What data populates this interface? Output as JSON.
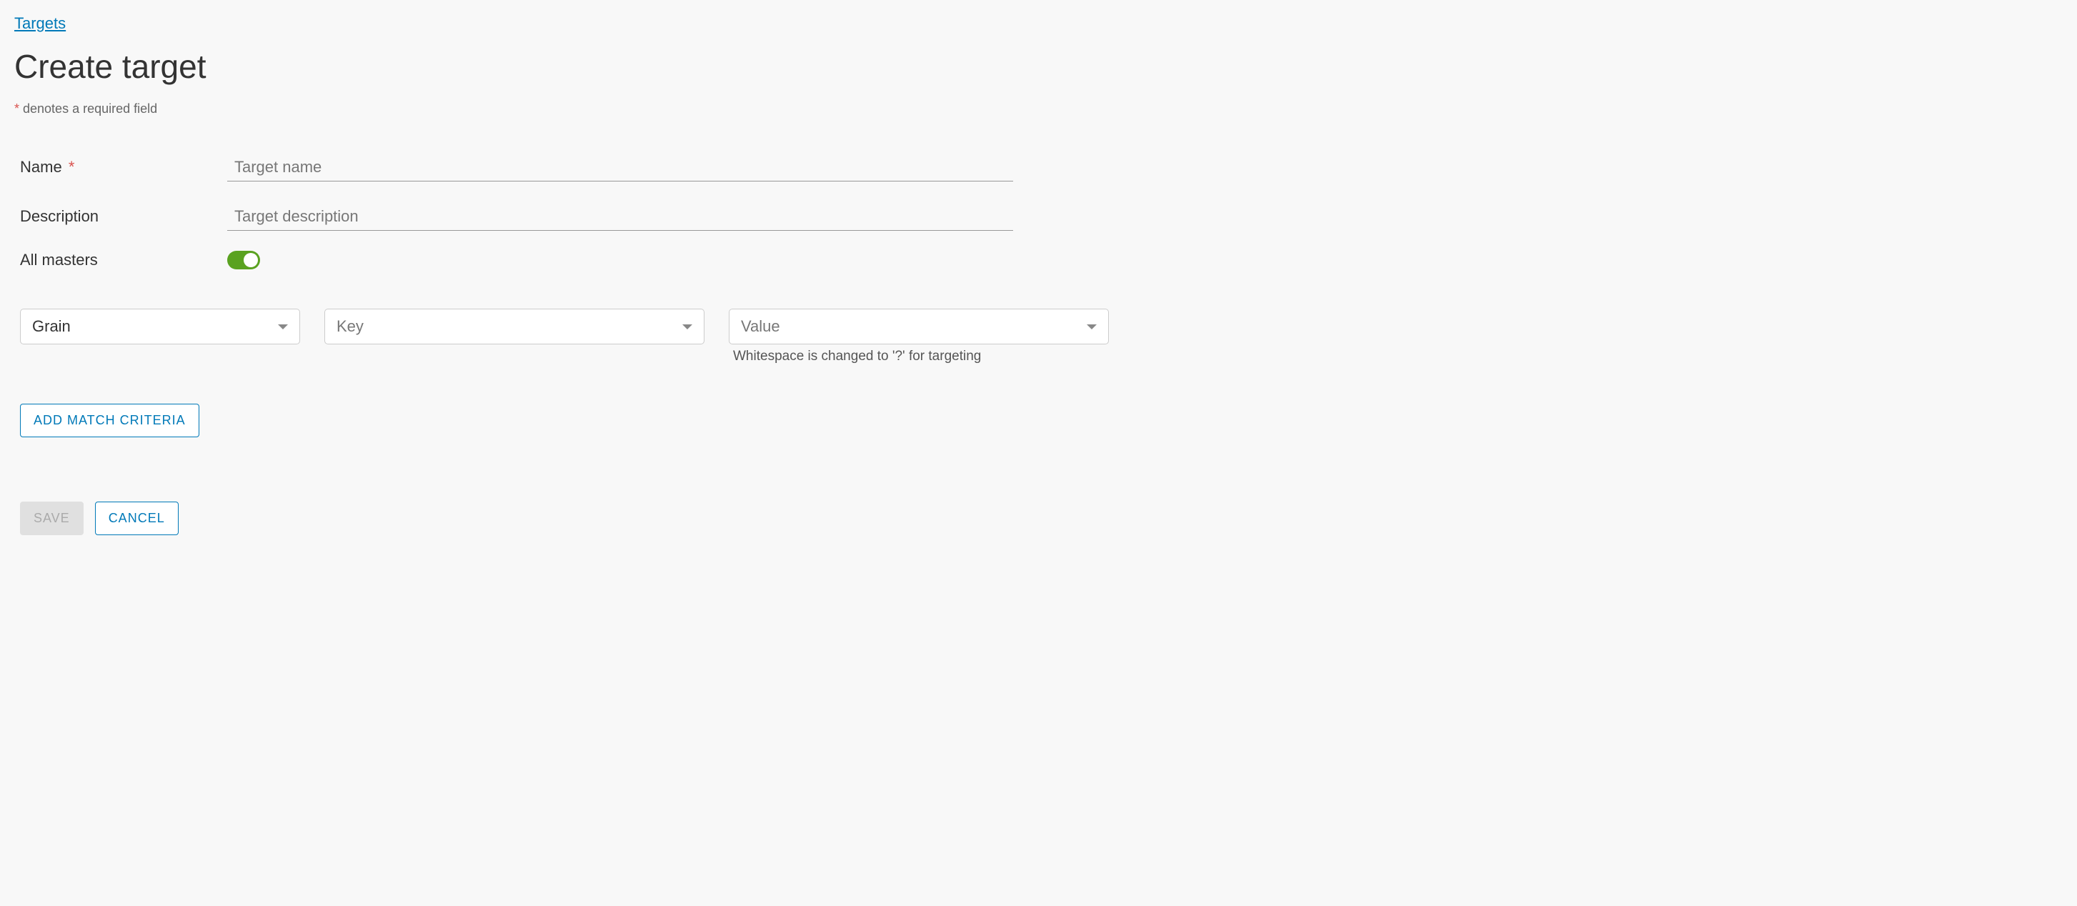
{
  "breadcrumb": {
    "label": "Targets"
  },
  "page": {
    "title": "Create target"
  },
  "required_note": {
    "marker": "*",
    "text": " denotes a required field"
  },
  "form": {
    "name": {
      "label": "Name",
      "required_marker": "*",
      "placeholder": "Target name",
      "value": ""
    },
    "description": {
      "label": "Description",
      "placeholder": "Target description",
      "value": ""
    },
    "all_masters": {
      "label": "All masters",
      "enabled": true
    }
  },
  "criteria": {
    "type": {
      "selected": "Grain"
    },
    "key": {
      "placeholder": "Key"
    },
    "value": {
      "placeholder": "Value",
      "hint": "Whitespace is changed to '?' for targeting"
    }
  },
  "buttons": {
    "add_criteria": "Add match criteria",
    "save": "Save",
    "cancel": "Cancel"
  }
}
